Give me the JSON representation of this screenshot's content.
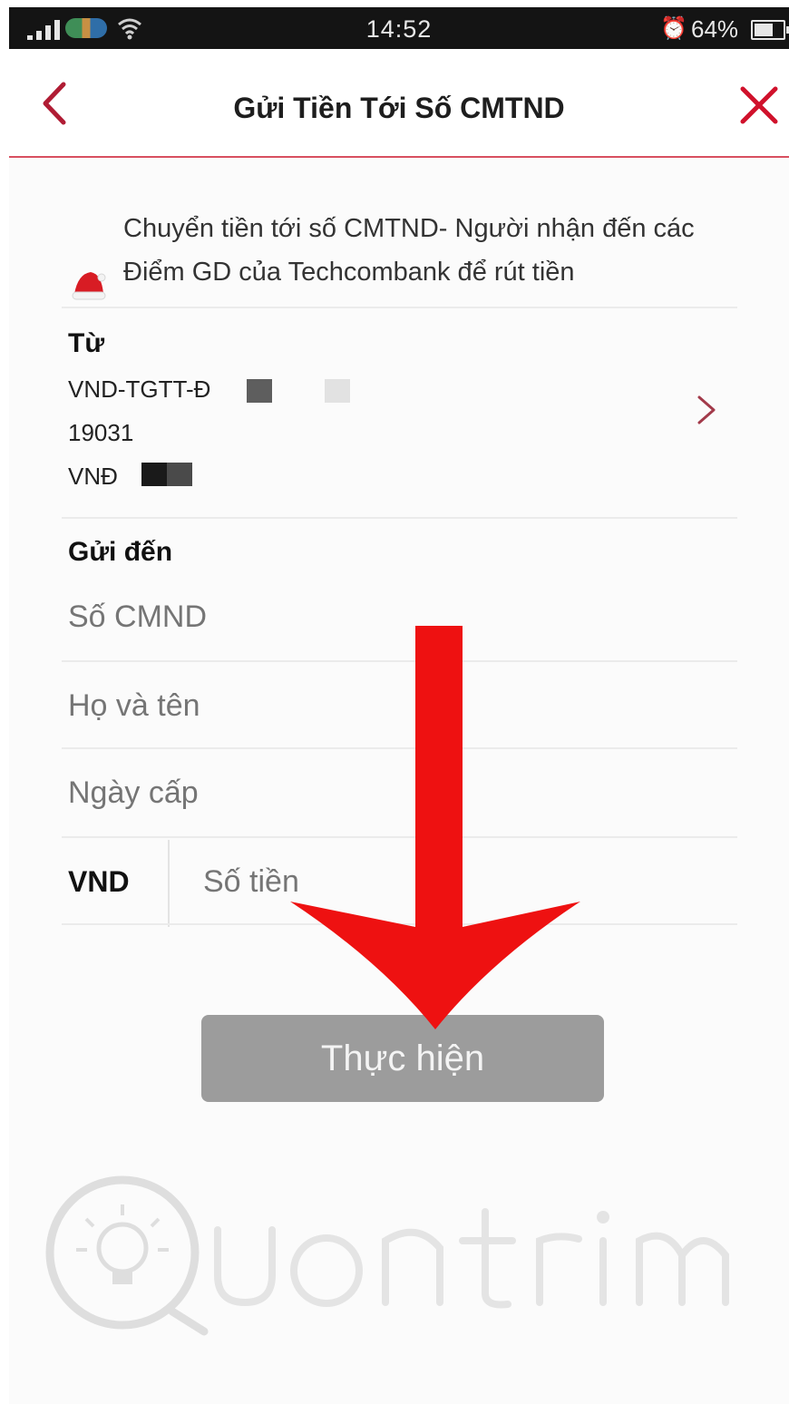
{
  "status_bar": {
    "time": "14:52",
    "battery": "64%",
    "icons": [
      "signal-icon",
      "carrier-logo-icon",
      "wifi-icon",
      "alarm-icon",
      "battery-icon"
    ]
  },
  "header": {
    "title": "Gửi Tiền Tới Số CMTND",
    "accent_color": "#c8102e"
  },
  "notice": {
    "icon": "santa-hat-icon",
    "text": "Chuyển tiền tới số CMTND- Người nhận đến các Điểm GD của Techcombank để rút tiền"
  },
  "from": {
    "label": "Từ",
    "account_name": "VND-TGTT-Đ",
    "account_number": "19031",
    "currency_prefix": "VNĐ"
  },
  "to": {
    "label": "Gửi đến",
    "id_number_placeholder": "Số CMND",
    "full_name_placeholder": "Họ và tên",
    "issue_date_placeholder": "Ngày cấp",
    "currency": "VND",
    "amount_placeholder": "Số tiền"
  },
  "submit": {
    "label": "Thực hiện",
    "disabled_color": "#9c9c9c"
  },
  "overlay": {
    "arrow_color": "#ee1111"
  }
}
